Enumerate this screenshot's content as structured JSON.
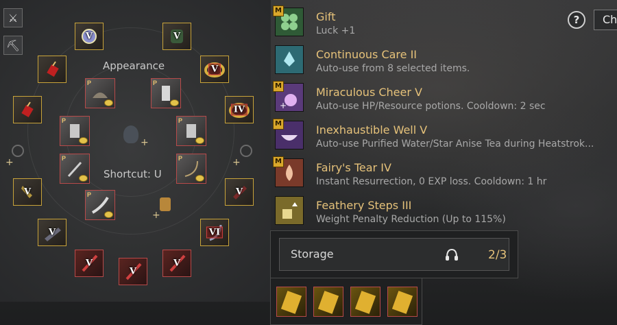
{
  "ring": {
    "appearance_label": "Appearance",
    "shortcut_label": "Shortcut: U",
    "slots": [
      {
        "name": "slot-necklace-top",
        "tier": "V",
        "color": "gold",
        "icon": "pendant"
      },
      {
        "name": "slot-armor-top",
        "tier": "V",
        "color": "gold",
        "icon": "armor"
      },
      {
        "name": "slot-earring-left",
        "tier": "",
        "color": "gold",
        "icon": "earring"
      },
      {
        "name": "slot-ring-right-top",
        "tier": "V",
        "color": "gold",
        "icon": "ring"
      },
      {
        "name": "slot-earring-left-2",
        "tier": "",
        "color": "gold",
        "icon": "earring"
      },
      {
        "name": "slot-ring-right",
        "tier": "IV",
        "color": "gold",
        "icon": "ring"
      },
      {
        "name": "slot-belt-left",
        "tier": "V",
        "color": "gold",
        "icon": "belt"
      },
      {
        "name": "slot-glove-right",
        "tier": "V",
        "color": "gold",
        "icon": "glove"
      },
      {
        "name": "slot-bracelet-left",
        "tier": "V",
        "color": "gold",
        "icon": "bracelet"
      },
      {
        "name": "slot-bow-right",
        "tier": "VI",
        "color": "gold",
        "icon": "bow"
      },
      {
        "name": "slot-weapon-bottom-left",
        "tier": "V",
        "color": "red",
        "icon": "sword"
      },
      {
        "name": "slot-weapon-bottom",
        "tier": "V",
        "color": "red",
        "icon": "sword"
      },
      {
        "name": "slot-weapon-bottom-right",
        "tier": "V",
        "color": "red",
        "icon": "sword"
      }
    ],
    "inner_slots": [
      {
        "name": "inner-hat",
        "badge": "P",
        "icon": "hat"
      },
      {
        "name": "inner-outfit-top",
        "badge": "P",
        "icon": "outfit"
      },
      {
        "name": "inner-outfit-left",
        "badge": "P",
        "icon": "outfit"
      },
      {
        "name": "inner-outfit-right",
        "badge": "P",
        "icon": "outfit"
      },
      {
        "name": "inner-dagger",
        "badge": "P",
        "icon": "dagger"
      },
      {
        "name": "inner-bow",
        "badge": "P",
        "icon": "bow"
      },
      {
        "name": "inner-blade",
        "badge": "P",
        "icon": "blade"
      }
    ]
  },
  "buffs": [
    {
      "title": "Gift",
      "desc": "Luck +1",
      "m": true,
      "color": "#2f5a36",
      "icon": "clover-icon"
    },
    {
      "title": "Continuous Care II",
      "desc": "Auto-use from 8 selected items.",
      "m": false,
      "color": "#2d6a73",
      "icon": "fairy-icon"
    },
    {
      "title": "Miraculous Cheer V",
      "desc": "Auto-use HP/Resource potions. Cooldown: 2 sec",
      "m": true,
      "color": "#5a3a7a",
      "icon": "potion-icon"
    },
    {
      "title": "Inexhaustible Well V",
      "desc": "Auto-use Purified Water/Star Anise Tea during Heatstrok...",
      "m": true,
      "color": "#4a2f6a",
      "icon": "bowl-icon"
    },
    {
      "title": "Fairy's Tear IV",
      "desc": "Instant Resurrection, 0 EXP loss. Cooldown: 1 hr",
      "m": true,
      "color": "#7a3a2a",
      "icon": "tear-icon"
    },
    {
      "title": "Feathery Steps III",
      "desc": "Weight Penalty Reduction (Up to 115%)",
      "m": false,
      "color": "#7a6a2a",
      "icon": "weight-icon"
    }
  ],
  "m_badge": "M",
  "help_label": "?",
  "ch_label": "Ch",
  "storage": {
    "label": "Storage",
    "count": "2/3"
  },
  "colors": {
    "gold": "#c9a43a",
    "red": "#b84a4a",
    "title": "#e6c27a"
  }
}
